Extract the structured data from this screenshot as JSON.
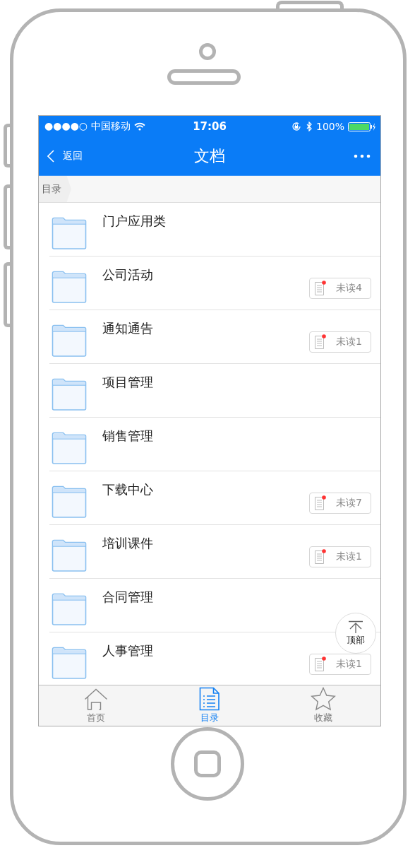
{
  "status_bar": {
    "carrier": "●●●●○ 中国移动",
    "time": "17:06",
    "battery": "100%"
  },
  "nav_bar": {
    "back": "返回",
    "title": "文档"
  },
  "breadcrumb": [
    "目录"
  ],
  "folders": [
    {
      "name": "门户应用类"
    },
    {
      "name": "公司活动",
      "unread": "未读4"
    },
    {
      "name": "通知通告",
      "unread": "未读1"
    },
    {
      "name": "项目管理"
    },
    {
      "name": "销售管理"
    },
    {
      "name": "下载中心",
      "unread": "未读7"
    },
    {
      "name": "培训课件",
      "unread": "未读1"
    },
    {
      "name": "合同管理"
    },
    {
      "name": "人事管理",
      "unread": "未读1"
    }
  ],
  "back_to_top": "顶部",
  "tab_bar": [
    {
      "label": "首页",
      "kind": "home",
      "selected": false
    },
    {
      "label": "目录",
      "kind": "list",
      "selected": true
    },
    {
      "label": "收藏",
      "kind": "star",
      "selected": false
    }
  ]
}
